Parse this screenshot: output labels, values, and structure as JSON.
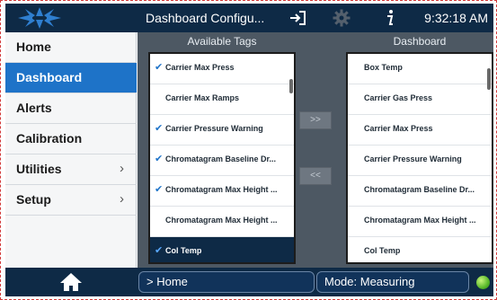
{
  "header": {
    "title": "Dashboard Configu...",
    "time": "9:32:18 AM"
  },
  "sidebar": {
    "items": [
      {
        "label": "Home",
        "active": false,
        "has_submenu": false
      },
      {
        "label": "Dashboard",
        "active": true,
        "has_submenu": false
      },
      {
        "label": "Alerts",
        "active": false,
        "has_submenu": false
      },
      {
        "label": "Calibration",
        "active": false,
        "has_submenu": false
      },
      {
        "label": "Utilities",
        "active": false,
        "has_submenu": true
      },
      {
        "label": "Setup",
        "active": false,
        "has_submenu": true
      }
    ]
  },
  "available": {
    "header": "Available Tags",
    "items": [
      {
        "label": "Carrier Max Press",
        "checked": true,
        "selected": false
      },
      {
        "label": "Carrier Max Ramps",
        "checked": false,
        "selected": false
      },
      {
        "label": "Carrier Pressure Warning",
        "checked": true,
        "selected": false
      },
      {
        "label": "Chromatagram Baseline Dr...",
        "checked": true,
        "selected": false
      },
      {
        "label": "Chromatagram Max Height ...",
        "checked": true,
        "selected": false
      },
      {
        "label": "Chromatagram Max Height ...",
        "checked": false,
        "selected": false
      },
      {
        "label": "Col Temp",
        "checked": true,
        "selected": true
      }
    ]
  },
  "dashboard": {
    "header": "Dashboard",
    "items": [
      {
        "label": "Box Temp"
      },
      {
        "label": "Carrier Gas Press"
      },
      {
        "label": "Carrier Max Press"
      },
      {
        "label": "Carrier Pressure Warning"
      },
      {
        "label": "Chromatagram Baseline Dr..."
      },
      {
        "label": "Chromatagram Max Height ..."
      },
      {
        "label": "Col Temp"
      }
    ]
  },
  "buttons": {
    "add": ">>",
    "remove": "<<"
  },
  "footer": {
    "breadcrumb": "> Home",
    "mode": "Mode: Measuring"
  },
  "icons": {
    "logo": "brand-logo-icon",
    "exit": "exit-icon",
    "settings": "gear-icon",
    "info": "info-icon",
    "home": "home-icon",
    "status": "status-led-icon",
    "check": "checkmark-icon",
    "chevron": "chevron-right-icon"
  },
  "colors": {
    "bar": "#0e2a46",
    "accent": "#1e73c8",
    "panel": "#4d5863",
    "status_ok": "#58b82a"
  }
}
